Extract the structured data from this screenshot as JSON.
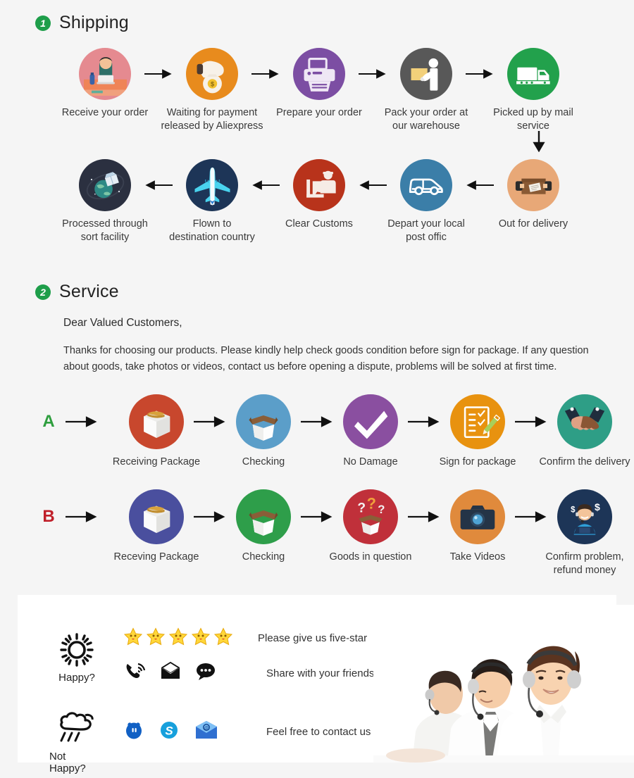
{
  "shipping": {
    "badge": "1",
    "title": "Shipping",
    "row1": [
      {
        "label": "Receive your order",
        "icon": "person-at-desk-icon",
        "color": "#e58a90"
      },
      {
        "label": "Waiting for payment\nreleased by Aliexpress",
        "icon": "hand-money-bag-icon",
        "color": "#e88b1d"
      },
      {
        "label": "Prepare your order",
        "icon": "printer-icon",
        "color": "#7c4ea3"
      },
      {
        "label": "Pack your order at\nour warehouse",
        "icon": "worker-packing-icon",
        "color": "#585858"
      },
      {
        "label": "Picked up by mail service",
        "icon": "delivery-truck-icon",
        "color": "#22a14c"
      }
    ],
    "row2": [
      {
        "label": "Out for delivery",
        "icon": "open-parcel-icon",
        "color": "#e8a877"
      },
      {
        "label": "Depart your local\npost offic",
        "icon": "delivery-van-icon",
        "color": "#3b7ea8"
      },
      {
        "label": "Clear  Customs",
        "icon": "customs-officer-icon",
        "color": "#b8331b"
      },
      {
        "label": "Flown to\ndestination country",
        "icon": "airplane-icon",
        "color": "#1d3557"
      },
      {
        "label": "Processed through\nsort facility",
        "icon": "globe-parcel-icon",
        "color": "#2b3040"
      }
    ],
    "down_arrow": "arrow-down-icon"
  },
  "service": {
    "badge": "2",
    "title": "Service",
    "salutation": "Dear Valued Customers,",
    "paragraph": "Thanks for choosing our products. Please kindly help check goods condition before sign for package. If any question about goods, take photos or videos, contact us before opening a dispute, problems will be solved at first time.",
    "rowA": {
      "letter": "A",
      "letter_color": "#2e9e3e",
      "steps": [
        {
          "label": "Receiving Package",
          "icon": "closed-box-icon",
          "color": "#c8472d"
        },
        {
          "label": "Checking",
          "icon": "open-box-icon",
          "color": "#5b9ec9"
        },
        {
          "label": "No Damage",
          "icon": "check-mark-icon",
          "color": "#8a4fa0"
        },
        {
          "label": "Sign for package",
          "icon": "signed-document-icon",
          "color": "#e8920f"
        },
        {
          "label": "Confirm the delivery",
          "icon": "handshake-icon",
          "color": "#2e9e86"
        }
      ]
    },
    "rowB": {
      "letter": "B",
      "letter_color": "#c0202a",
      "steps": [
        {
          "label": "Receving Package",
          "icon": "closed-box-icon",
          "color": "#4a4f9e"
        },
        {
          "label": "Checking",
          "icon": "open-box-icon",
          "color": "#2e9e4a"
        },
        {
          "label": "Goods in question",
          "icon": "question-box-icon",
          "color": "#c0303a"
        },
        {
          "label": "Take Videos",
          "icon": "camera-icon",
          "color": "#e08a3c"
        },
        {
          "label": "Confirm problem,\nrefund money",
          "icon": "agent-laptop-money-icon",
          "color": "#1d3557"
        }
      ]
    }
  },
  "contact_panel": {
    "happy": {
      "icon": "sun-icon",
      "label": "Happy?",
      "stars": {
        "icon": "star-icon",
        "count": 5,
        "color": "#ffd73a"
      },
      "star_message": "Please give us five-star",
      "share_icons": [
        "phone-ring-icon",
        "envelope-icon",
        "speech-bubble-icon"
      ],
      "share_message": "Share with your friends"
    },
    "not_happy": {
      "icon": "rain-cloud-icon",
      "label": "Not Happy?",
      "contact_icons": [
        "qq-icon",
        "skype-icon",
        "email-icon"
      ],
      "contact_message": "Feel free to contact us"
    },
    "photo": "call-center-agents-photo"
  }
}
